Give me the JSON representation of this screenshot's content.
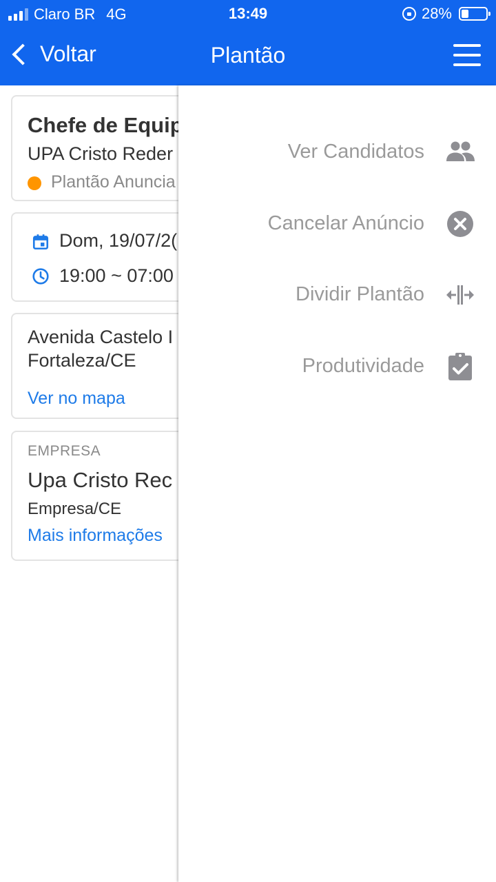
{
  "status_bar": {
    "carrier": "Claro BR",
    "network": "4G",
    "time": "13:49",
    "battery_percent": "28%",
    "battery_level": 0.28
  },
  "nav": {
    "back_label": "Voltar",
    "title": "Plantão"
  },
  "cards": {
    "shift": {
      "role": "Chefe de Equip",
      "unit": "UPA Cristo Reder",
      "status": "Plantão Anuncia",
      "status_color": "#ff9500"
    },
    "schedule": {
      "date": "Dom, 19/07/2(",
      "hours": "19:00 ~ 07:00"
    },
    "location": {
      "address_line1": "Avenida Castelo I",
      "address_line2": "Fortaleza/CE",
      "map_link": "Ver no mapa"
    },
    "company": {
      "label": "EMPRESA",
      "name": "Upa Cristo Rec",
      "city": "Empresa/CE",
      "more_link": "Mais informações"
    }
  },
  "drawer": {
    "items": [
      {
        "label": "Ver Candidatos",
        "icon": "people-icon"
      },
      {
        "label": "Cancelar Anúncio",
        "icon": "cancel-circle-icon"
      },
      {
        "label": "Dividir Plantão",
        "icon": "split-arrows-icon"
      },
      {
        "label": "Produtividade",
        "icon": "clipboard-check-icon"
      }
    ]
  },
  "colors": {
    "primary": "#1166ee",
    "link": "#1e7be8",
    "menu_text": "#9a9a9a",
    "menu_icon": "#8e8e93"
  }
}
